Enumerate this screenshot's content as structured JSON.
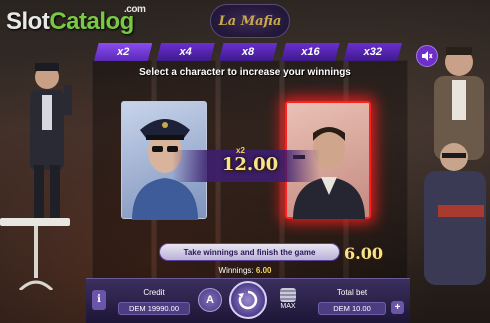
{
  "watermark": {
    "slot": "Slot",
    "catalog": "Catalog",
    "com": ".com"
  },
  "game_logo": "La Mafia",
  "multipliers": [
    "x2",
    "x4",
    "x8",
    "x16",
    "x32"
  ],
  "instruction": "Select a character to increase your winnings",
  "card_multiplier": "x2",
  "card_value": "12.00",
  "take_button": "Take winnings and finish the game",
  "take_value": "6.00",
  "winnings": {
    "label": "Winnings:",
    "value": "6.00"
  },
  "controls": {
    "info_label": "i",
    "credit_label": "Credit",
    "credit_value": "DEM 19990.00",
    "auto_label": "A",
    "max_label": "MAX",
    "total_bet_label": "Total bet",
    "total_bet_value": "DEM 10.00",
    "plus_label": "+"
  },
  "icons": {
    "sound": "speaker-muted-icon",
    "spin": "spin-arrows-icon",
    "coins": "coin-stack-icon"
  },
  "colors": {
    "accent": "#6a2fd0",
    "highlight": "#ff2020",
    "gold": "#f7e38a"
  }
}
